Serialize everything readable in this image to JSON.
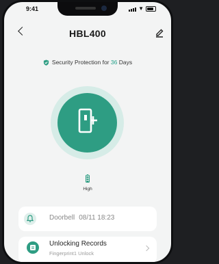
{
  "status_bar": {
    "time": "9:41"
  },
  "header": {
    "title": "HBL400",
    "back_icon": "chevron-left-icon",
    "edit_icon": "pencil-icon"
  },
  "security": {
    "prefix": "Security Protection for ",
    "days": "36",
    "suffix": " Days",
    "icon": "shield-check-icon",
    "accent": "#1f9e86"
  },
  "lock_button": {
    "icon": "door-unlock-icon",
    "color": "#2e9d83"
  },
  "battery": {
    "label": "High",
    "icon": "battery-icon"
  },
  "doorbell": {
    "label": "Doorbell",
    "datetime": "08/11 18:23",
    "icon": "bell-icon"
  },
  "records": {
    "title": "Unlocking Records",
    "subtitle": "Fingerprint1 Unlock",
    "icon": "records-icon"
  }
}
